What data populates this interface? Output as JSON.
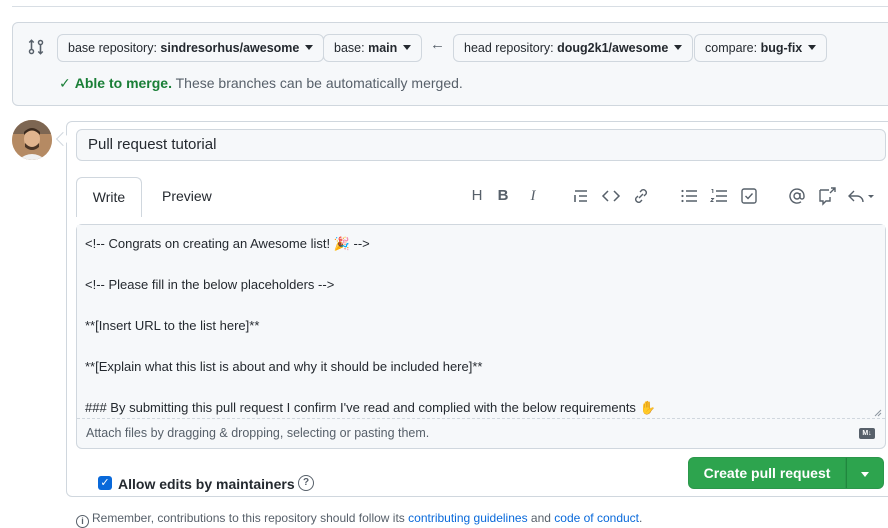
{
  "compare": {
    "base_repo_label": "base repository:",
    "base_repo_value": "sindresorhus/awesome",
    "base_label": "base:",
    "base_value": "main",
    "head_repo_label": "head repository:",
    "head_repo_value": "doug2k1/awesome",
    "compare_label": "compare:",
    "compare_value": "bug-fix",
    "merge_ok": "Able to merge.",
    "merge_text": "These branches can be automatically merged."
  },
  "pr": {
    "title": "Pull request tutorial"
  },
  "tabs": {
    "write": "Write",
    "preview": "Preview"
  },
  "toolbar": {
    "heading": "H",
    "bold": "B",
    "italic": "I"
  },
  "body": {
    "lines": [
      "<!-- Congrats on creating an Awesome list! 🎉 -->",
      "<!-- Please fill in the below placeholders -->",
      "**[Insert URL to the list here]**",
      "**[Explain what this list is about and why it should be included here]**",
      "### By submitting this pull request I confirm I've read and complied with the below requirements ✋"
    ],
    "attach_hint": "Attach files by dragging & dropping, selecting or pasting them.",
    "markdown_badge": "M↓"
  },
  "options": {
    "allow_edits": "Allow edits by maintainers",
    "help": "?"
  },
  "actions": {
    "create": "Create pull request"
  },
  "footer": {
    "text_before": "Remember, contributions to this repository should follow its ",
    "link1": "contributing guidelines",
    "text_mid": " and ",
    "link2": "code of conduct",
    "text_end": "."
  },
  "colors": {
    "accent_green": "#2da44e",
    "merge_green": "#1a7f37",
    "link_blue": "#0969da"
  }
}
